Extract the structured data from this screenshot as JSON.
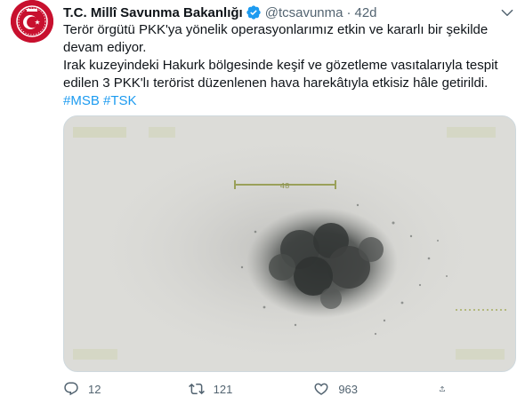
{
  "author": {
    "name": "T.C. Millî Savunma Bakanlığı",
    "handle": "@tcsavunma",
    "separator": "·",
    "time": "42d",
    "avatar_icon": "ministry-emblem-icon",
    "verified_icon": "verified-badge-icon"
  },
  "tweet": {
    "line1": "Terör örgütü PKK'ya yönelik operasyonlarımız etkin ve kararlı bir şekilde devam ediyor.",
    "line2": "Irak kuzeyindeki Hakurk bölgesinde keşif ve gözetleme vasıtalarıyla tespit edilen 3 PKK'lı terörist düzenlenen hava harekâtıyla etkisiz hâle getirildi.",
    "hashtags": [
      "#MSB",
      "#TSK"
    ]
  },
  "media": {
    "overlay_text": "48"
  },
  "actions": {
    "replies": "12",
    "retweets": "121",
    "likes": "963"
  },
  "colors": {
    "accent": "#1d9bf0",
    "muted": "#536471",
    "brand_red": "#c8102e"
  }
}
